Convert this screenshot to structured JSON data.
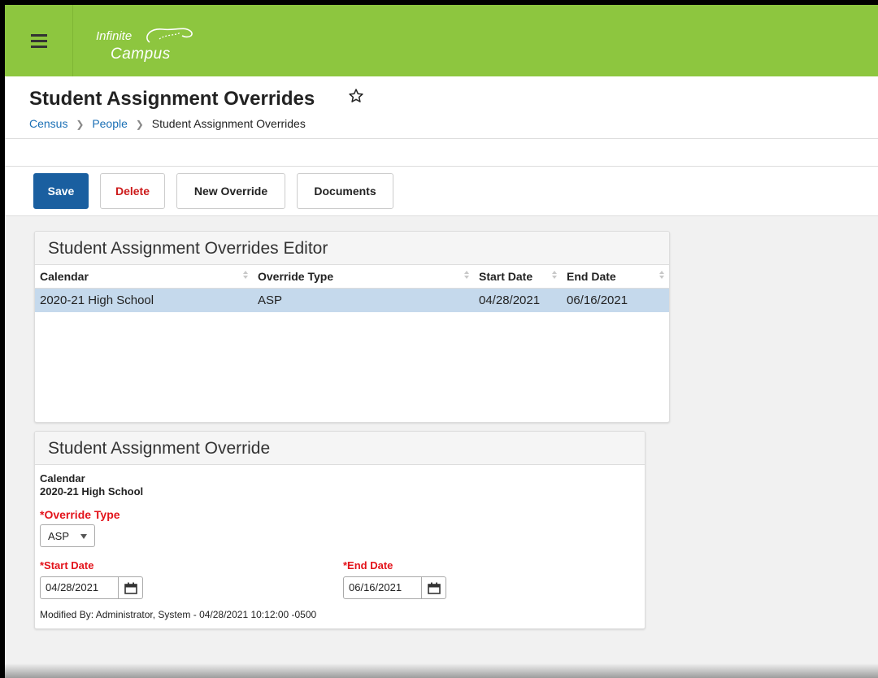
{
  "app": {
    "logo_line1": "Infinite",
    "logo_line2": "Campus"
  },
  "header": {
    "title": "Student Assignment Overrides",
    "breadcrumb": [
      "Census",
      "People",
      "Student Assignment Overrides"
    ]
  },
  "toolbar": {
    "save_label": "Save",
    "delete_label": "Delete",
    "new_override_label": "New Override",
    "documents_label": "Documents"
  },
  "editor": {
    "title": "Student Assignment Overrides Editor",
    "columns": [
      "Calendar",
      "Override Type",
      "Start Date",
      "End Date"
    ],
    "rows": [
      {
        "calendar": "2020-21 High School",
        "override_type": "ASP",
        "start_date": "04/28/2021",
        "end_date": "06/16/2021"
      }
    ]
  },
  "form": {
    "title": "Student Assignment Override",
    "calendar_label": "Calendar",
    "calendar_value": "2020-21 High School",
    "override_type_label": "*Override Type",
    "override_type_value": "ASP",
    "start_date_label": "*Start Date",
    "start_date_value": "04/28/2021",
    "end_date_label": "*End Date",
    "end_date_value": "06/16/2021",
    "modified_by": "Modified By: Administrator, System - 04/28/2021 10:12:00 -0500"
  },
  "colors": {
    "topbar": "#8dc63f",
    "save_button": "#1a5fa0",
    "delete_text": "#cc1a1a",
    "required_label": "#e3131b",
    "selected_row": "#c5d9ec",
    "link": "#1a6fb5"
  },
  "icons": {
    "menu": "hamburger-menu-icon",
    "favorite": "star-outline-icon",
    "breadcrumb_separator": "chevron-right-icon",
    "date_picker": "calendar-icon"
  }
}
